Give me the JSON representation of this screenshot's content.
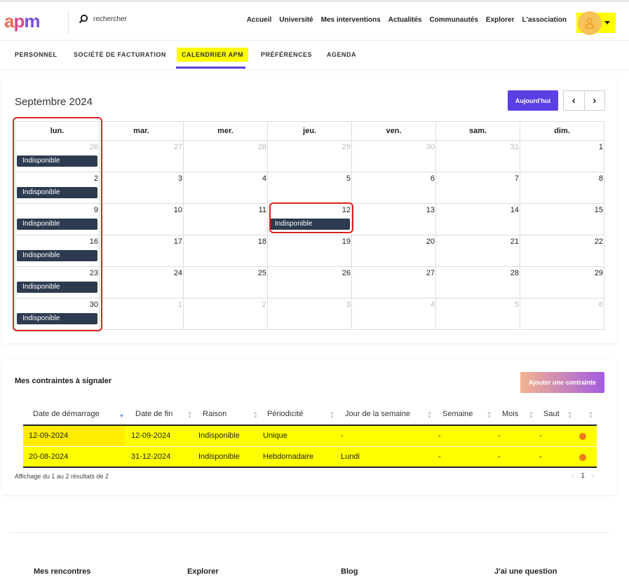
{
  "header": {
    "logo": "apm",
    "search_placeholder": "rechercher",
    "nav": [
      "Accueil",
      "Université",
      "Mes interventions",
      "Actualités",
      "Communautés",
      "Explorer",
      "L'association"
    ]
  },
  "tabs": [
    "PERSONNEL",
    "SOCIÉTÉ DE FACTURATION",
    "CALENDRIER APM",
    "PRÉFÉRENCES",
    "AGENDA"
  ],
  "calendar": {
    "title": "Septembre 2024",
    "today_label": "Aujourd'hui",
    "weekdays": [
      "lun.",
      "mar.",
      "mer.",
      "jeu.",
      "ven.",
      "sam.",
      "dim."
    ],
    "event_label": "Indisponible",
    "weeks": [
      [
        "26",
        "27",
        "28",
        "29",
        "30",
        "31",
        "1"
      ],
      [
        "2",
        "3",
        "4",
        "5",
        "6",
        "7",
        "8"
      ],
      [
        "9",
        "10",
        "11",
        "12",
        "13",
        "14",
        "15"
      ],
      [
        "16",
        "17",
        "18",
        "19",
        "20",
        "21",
        "22"
      ],
      [
        "23",
        "24",
        "25",
        "26",
        "27",
        "28",
        "29"
      ],
      [
        "30",
        "1",
        "2",
        "3",
        "4",
        "5",
        "6"
      ]
    ]
  },
  "constraints": {
    "title": "Mes contraintes à signaler",
    "add_button": "Ajouter une contrainte",
    "columns": [
      "Date de démarrage",
      "Date de fin",
      "Raison",
      "Périodicité",
      "Jour de la semaine",
      "Semaine",
      "Mois",
      "Saut"
    ],
    "rows": [
      [
        "12-09-2024",
        "12-09-2024",
        "Indisponible",
        "Unique",
        "-",
        "-",
        "-",
        "-"
      ],
      [
        "20-08-2024",
        "31-12-2024",
        "Indisponible",
        "Hebdomadaire",
        "Lundi",
        "-",
        "-",
        "-"
      ]
    ],
    "info": "Affichage du 1 au 2 résultats de 2",
    "page": "1"
  },
  "footer": [
    "Mes rencontres",
    "Explorer",
    "Blog",
    "J'ai une question"
  ],
  "colors": {
    "accent": "#5b3fe4",
    "event": "#2d3b50",
    "highlight": "#ffff00",
    "status_dot": "#f07a16"
  }
}
